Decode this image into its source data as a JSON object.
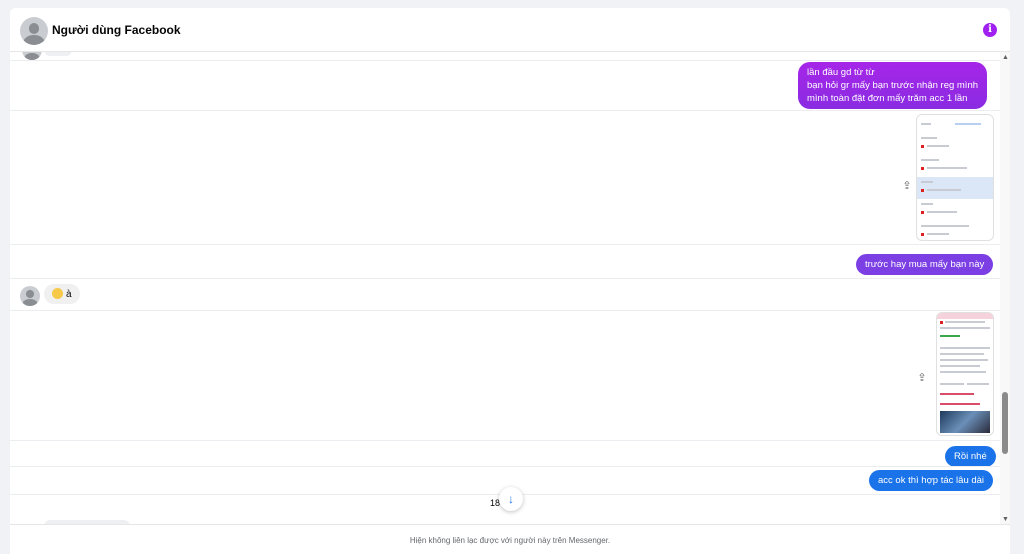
{
  "header": {
    "title": "Người dùng Facebook",
    "info_icon": "info-icon",
    "accent": "#a020f0"
  },
  "messages": {
    "m1_lines": [
      "lần đầu gd từ từ",
      "bạn hỏi gr mấy bạn trước nhận reg mình",
      "mình toàn đặt đơn mấy trăm acc 1 lần"
    ],
    "m2": "trước hay mua mấy bạn này",
    "m3": "à",
    "m4": "Rồi nhé",
    "m5": "acc ok thì hợp tác lâu dài"
  },
  "colors": {
    "purple": "#9b27e6",
    "violet": "#7b3fe4",
    "blue": "#1a73e8"
  },
  "jump": {
    "count": "18",
    "icon": "arrow-down-icon"
  },
  "footer": {
    "note": "Hiện không liên lạc được với người này trên Messenger."
  }
}
